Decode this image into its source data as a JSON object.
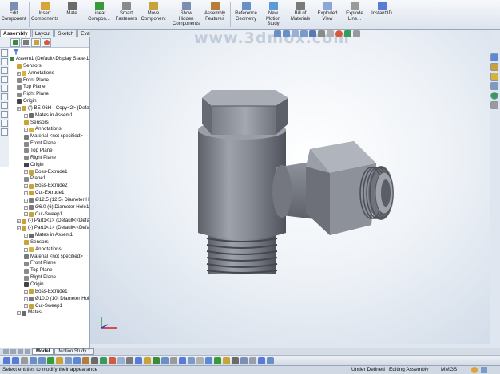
{
  "ribbon": {
    "buttons": [
      {
        "label": "Edit\nComponent",
        "icon": "edit-component-icon",
        "color": "#7b8fb5"
      },
      {
        "label": "Insert\nComponents",
        "icon": "insert-components-icon",
        "color": "#d7a33a"
      },
      {
        "label": "Mate",
        "icon": "mate-icon",
        "color": "#6a6a6a"
      },
      {
        "label": "Linear\nCompon...",
        "icon": "linear-pattern-icon",
        "color": "#3a9a3a"
      },
      {
        "label": "Smart\nFasteners",
        "icon": "smart-fasteners-icon",
        "color": "#8a8a8a"
      },
      {
        "label": "Move\nComponent",
        "icon": "move-component-icon",
        "color": "#c9a23a"
      },
      {
        "label": "Show\nHidden\nComponents",
        "icon": "show-hidden-icon",
        "color": "#7b8fb5"
      },
      {
        "label": "Assembly\nFeatures",
        "icon": "assembly-features-icon",
        "color": "#b77b3a"
      },
      {
        "label": "Reference\nGeometry",
        "icon": "reference-geometry-icon",
        "color": "#6a8fc7"
      },
      {
        "label": "New\nMotion\nStudy",
        "icon": "motion-study-icon",
        "color": "#5a9ad7"
      },
      {
        "label": "Bill of\nMaterials",
        "icon": "bom-icon",
        "color": "#7a7a7a"
      },
      {
        "label": "Exploded\nView",
        "icon": "exploded-view-icon",
        "color": "#8aa7d7"
      },
      {
        "label": "Explode\nLine...",
        "icon": "explode-line-icon",
        "color": "#9a9a9a"
      },
      {
        "label": "Instant3D",
        "icon": "instant3d-icon",
        "color": "#5a7ad7"
      }
    ]
  },
  "command_tabs": [
    "Assembly",
    "Layout",
    "Sketch",
    "Evaluate"
  ],
  "watermark": "www.3dmox.com",
  "tree": [
    {
      "label": "Assem1  (Default<Display State-1",
      "indent": 0,
      "icon": "assembly-icon",
      "color": "#3a8a3a"
    },
    {
      "label": "Sensors",
      "indent": 1,
      "icon": "sensors-icon",
      "color": "#c9a23a"
    },
    {
      "label": "Annotations",
      "indent": 1,
      "icon": "annotations-icon",
      "color": "#d7b33a"
    },
    {
      "label": "Front Plane",
      "indent": 1,
      "icon": "plane-icon",
      "color": "#8a8a8a"
    },
    {
      "label": "Top Plane",
      "indent": 1,
      "icon": "plane-icon",
      "color": "#8a8a8a"
    },
    {
      "label": "Right Plane",
      "indent": 1,
      "icon": "plane-icon",
      "color": "#8a8a8a"
    },
    {
      "label": "Origin",
      "indent": 1,
      "icon": "origin-icon",
      "color": "#444444"
    },
    {
      "label": "(f) BE-06H - Copy<2> (Default",
      "indent": 1,
      "icon": "part-icon",
      "color": "#c9a23a"
    },
    {
      "label": "Mates in Assem1",
      "indent": 2,
      "icon": "mates-icon",
      "color": "#6a6a6a"
    },
    {
      "label": "Sensors",
      "indent": 2,
      "icon": "sensors-icon",
      "color": "#c9a23a"
    },
    {
      "label": "Annotations",
      "indent": 2,
      "icon": "annotations-icon",
      "color": "#d7b33a"
    },
    {
      "label": "Material <not specified>",
      "indent": 2,
      "icon": "material-icon",
      "color": "#7a7a7a"
    },
    {
      "label": "Front Plane",
      "indent": 2,
      "icon": "plane-icon",
      "color": "#8a8a8a"
    },
    {
      "label": "Top Plane",
      "indent": 2,
      "icon": "plane-icon",
      "color": "#8a8a8a"
    },
    {
      "label": "Right Plane",
      "indent": 2,
      "icon": "plane-icon",
      "color": "#8a8a8a"
    },
    {
      "label": "Origin",
      "indent": 2,
      "icon": "origin-icon",
      "color": "#444444"
    },
    {
      "label": "Boss-Extrude1",
      "indent": 2,
      "icon": "extrude-icon",
      "color": "#c9a23a"
    },
    {
      "label": "Plane1",
      "indent": 2,
      "icon": "plane-icon",
      "color": "#8a8a8a"
    },
    {
      "label": "Boss-Extrude2",
      "indent": 2,
      "icon": "extrude-icon",
      "color": "#c9a23a"
    },
    {
      "label": "Cut-Extrude1",
      "indent": 2,
      "icon": "cut-icon",
      "color": "#c9a23a"
    },
    {
      "label": "Ø12.5 (12.5) Diameter Hole1",
      "indent": 2,
      "icon": "hole-icon",
      "color": "#7a7a7a"
    },
    {
      "label": "Ø6.0 (6) Diameter Hole1",
      "indent": 2,
      "icon": "hole-icon",
      "color": "#7a7a7a"
    },
    {
      "label": "Cut-Sweep1",
      "indent": 2,
      "icon": "sweep-icon",
      "color": "#c9a23a"
    },
    {
      "label": "(-) Part1<1> (Default<<Defau",
      "indent": 1,
      "icon": "part-icon",
      "color": "#c9a23a"
    },
    {
      "label": "(-) Part1<1> (Default<<Defau",
      "indent": 1,
      "icon": "part-icon",
      "color": "#c9a23a"
    },
    {
      "label": "Mates in Assem1",
      "indent": 2,
      "icon": "mates-icon",
      "color": "#6a6a6a"
    },
    {
      "label": "Sensors",
      "indent": 2,
      "icon": "sensors-icon",
      "color": "#c9a23a"
    },
    {
      "label": "Annotations",
      "indent": 2,
      "icon": "annotations-icon",
      "color": "#d7b33a"
    },
    {
      "label": "Material <not specified>",
      "indent": 2,
      "icon": "material-icon",
      "color": "#7a7a7a"
    },
    {
      "label": "Front Plane",
      "indent": 2,
      "icon": "plane-icon",
      "color": "#8a8a8a"
    },
    {
      "label": "Top Plane",
      "indent": 2,
      "icon": "plane-icon",
      "color": "#8a8a8a"
    },
    {
      "label": "Right Plane",
      "indent": 2,
      "icon": "plane-icon",
      "color": "#8a8a8a"
    },
    {
      "label": "Origin",
      "indent": 2,
      "icon": "origin-icon",
      "color": "#444444"
    },
    {
      "label": "Boss-Extrude1",
      "indent": 2,
      "icon": "extrude-icon",
      "color": "#c9a23a"
    },
    {
      "label": "Ø10.0 (10) Diameter Hole1",
      "indent": 2,
      "icon": "hole-icon",
      "color": "#7a7a7a"
    },
    {
      "label": "Cut-Sweep1",
      "indent": 2,
      "icon": "sweep-icon",
      "color": "#c9a23a"
    },
    {
      "label": "Mates",
      "indent": 1,
      "icon": "mates-icon",
      "color": "#6a6a6a"
    }
  ],
  "bottom_tabs": [
    "Model",
    "Motion Study 1"
  ],
  "status": {
    "message": "Select entities to modify their appearance",
    "state": "Under Defined",
    "mode": "Editing Assembly",
    "units": "MMGS"
  },
  "colors": {
    "part_body": "#8c8f97",
    "ribbon_bg": "#e6ebf2",
    "selected_tab": "#ffffff"
  }
}
